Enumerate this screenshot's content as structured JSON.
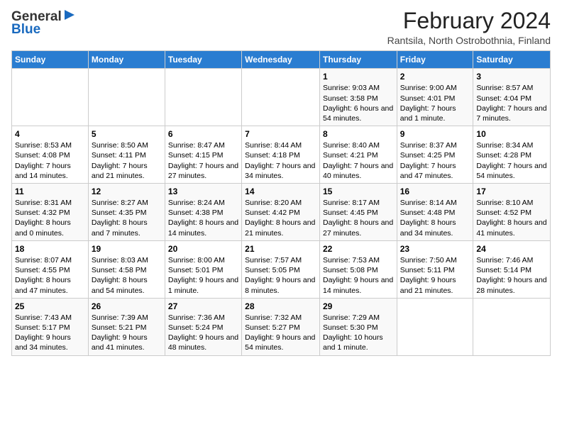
{
  "header": {
    "logo_general": "General",
    "logo_blue": "Blue",
    "title": "February 2024",
    "subtitle": "Rantsila, North Ostrobothnia, Finland"
  },
  "calendar": {
    "days_of_week": [
      "Sunday",
      "Monday",
      "Tuesday",
      "Wednesday",
      "Thursday",
      "Friday",
      "Saturday"
    ],
    "weeks": [
      [
        {
          "day": "",
          "sunrise": "",
          "sunset": "",
          "daylight": ""
        },
        {
          "day": "",
          "sunrise": "",
          "sunset": "",
          "daylight": ""
        },
        {
          "day": "",
          "sunrise": "",
          "sunset": "",
          "daylight": ""
        },
        {
          "day": "",
          "sunrise": "",
          "sunset": "",
          "daylight": ""
        },
        {
          "day": "1",
          "sunrise": "Sunrise: 9:03 AM",
          "sunset": "Sunset: 3:58 PM",
          "daylight": "Daylight: 6 hours and 54 minutes."
        },
        {
          "day": "2",
          "sunrise": "Sunrise: 9:00 AM",
          "sunset": "Sunset: 4:01 PM",
          "daylight": "Daylight: 7 hours and 1 minute."
        },
        {
          "day": "3",
          "sunrise": "Sunrise: 8:57 AM",
          "sunset": "Sunset: 4:04 PM",
          "daylight": "Daylight: 7 hours and 7 minutes."
        }
      ],
      [
        {
          "day": "4",
          "sunrise": "Sunrise: 8:53 AM",
          "sunset": "Sunset: 4:08 PM",
          "daylight": "Daylight: 7 hours and 14 minutes."
        },
        {
          "day": "5",
          "sunrise": "Sunrise: 8:50 AM",
          "sunset": "Sunset: 4:11 PM",
          "daylight": "Daylight: 7 hours and 21 minutes."
        },
        {
          "day": "6",
          "sunrise": "Sunrise: 8:47 AM",
          "sunset": "Sunset: 4:15 PM",
          "daylight": "Daylight: 7 hours and 27 minutes."
        },
        {
          "day": "7",
          "sunrise": "Sunrise: 8:44 AM",
          "sunset": "Sunset: 4:18 PM",
          "daylight": "Daylight: 7 hours and 34 minutes."
        },
        {
          "day": "8",
          "sunrise": "Sunrise: 8:40 AM",
          "sunset": "Sunset: 4:21 PM",
          "daylight": "Daylight: 7 hours and 40 minutes."
        },
        {
          "day": "9",
          "sunrise": "Sunrise: 8:37 AM",
          "sunset": "Sunset: 4:25 PM",
          "daylight": "Daylight: 7 hours and 47 minutes."
        },
        {
          "day": "10",
          "sunrise": "Sunrise: 8:34 AM",
          "sunset": "Sunset: 4:28 PM",
          "daylight": "Daylight: 7 hours and 54 minutes."
        }
      ],
      [
        {
          "day": "11",
          "sunrise": "Sunrise: 8:31 AM",
          "sunset": "Sunset: 4:32 PM",
          "daylight": "Daylight: 8 hours and 0 minutes."
        },
        {
          "day": "12",
          "sunrise": "Sunrise: 8:27 AM",
          "sunset": "Sunset: 4:35 PM",
          "daylight": "Daylight: 8 hours and 7 minutes."
        },
        {
          "day": "13",
          "sunrise": "Sunrise: 8:24 AM",
          "sunset": "Sunset: 4:38 PM",
          "daylight": "Daylight: 8 hours and 14 minutes."
        },
        {
          "day": "14",
          "sunrise": "Sunrise: 8:20 AM",
          "sunset": "Sunset: 4:42 PM",
          "daylight": "Daylight: 8 hours and 21 minutes."
        },
        {
          "day": "15",
          "sunrise": "Sunrise: 8:17 AM",
          "sunset": "Sunset: 4:45 PM",
          "daylight": "Daylight: 8 hours and 27 minutes."
        },
        {
          "day": "16",
          "sunrise": "Sunrise: 8:14 AM",
          "sunset": "Sunset: 4:48 PM",
          "daylight": "Daylight: 8 hours and 34 minutes."
        },
        {
          "day": "17",
          "sunrise": "Sunrise: 8:10 AM",
          "sunset": "Sunset: 4:52 PM",
          "daylight": "Daylight: 8 hours and 41 minutes."
        }
      ],
      [
        {
          "day": "18",
          "sunrise": "Sunrise: 8:07 AM",
          "sunset": "Sunset: 4:55 PM",
          "daylight": "Daylight: 8 hours and 47 minutes."
        },
        {
          "day": "19",
          "sunrise": "Sunrise: 8:03 AM",
          "sunset": "Sunset: 4:58 PM",
          "daylight": "Daylight: 8 hours and 54 minutes."
        },
        {
          "day": "20",
          "sunrise": "Sunrise: 8:00 AM",
          "sunset": "Sunset: 5:01 PM",
          "daylight": "Daylight: 9 hours and 1 minute."
        },
        {
          "day": "21",
          "sunrise": "Sunrise: 7:57 AM",
          "sunset": "Sunset: 5:05 PM",
          "daylight": "Daylight: 9 hours and 8 minutes."
        },
        {
          "day": "22",
          "sunrise": "Sunrise: 7:53 AM",
          "sunset": "Sunset: 5:08 PM",
          "daylight": "Daylight: 9 hours and 14 minutes."
        },
        {
          "day": "23",
          "sunrise": "Sunrise: 7:50 AM",
          "sunset": "Sunset: 5:11 PM",
          "daylight": "Daylight: 9 hours and 21 minutes."
        },
        {
          "day": "24",
          "sunrise": "Sunrise: 7:46 AM",
          "sunset": "Sunset: 5:14 PM",
          "daylight": "Daylight: 9 hours and 28 minutes."
        }
      ],
      [
        {
          "day": "25",
          "sunrise": "Sunrise: 7:43 AM",
          "sunset": "Sunset: 5:17 PM",
          "daylight": "Daylight: 9 hours and 34 minutes."
        },
        {
          "day": "26",
          "sunrise": "Sunrise: 7:39 AM",
          "sunset": "Sunset: 5:21 PM",
          "daylight": "Daylight: 9 hours and 41 minutes."
        },
        {
          "day": "27",
          "sunrise": "Sunrise: 7:36 AM",
          "sunset": "Sunset: 5:24 PM",
          "daylight": "Daylight: 9 hours and 48 minutes."
        },
        {
          "day": "28",
          "sunrise": "Sunrise: 7:32 AM",
          "sunset": "Sunset: 5:27 PM",
          "daylight": "Daylight: 9 hours and 54 minutes."
        },
        {
          "day": "29",
          "sunrise": "Sunrise: 7:29 AM",
          "sunset": "Sunset: 5:30 PM",
          "daylight": "Daylight: 10 hours and 1 minute."
        },
        {
          "day": "",
          "sunrise": "",
          "sunset": "",
          "daylight": ""
        },
        {
          "day": "",
          "sunrise": "",
          "sunset": "",
          "daylight": ""
        }
      ]
    ]
  }
}
